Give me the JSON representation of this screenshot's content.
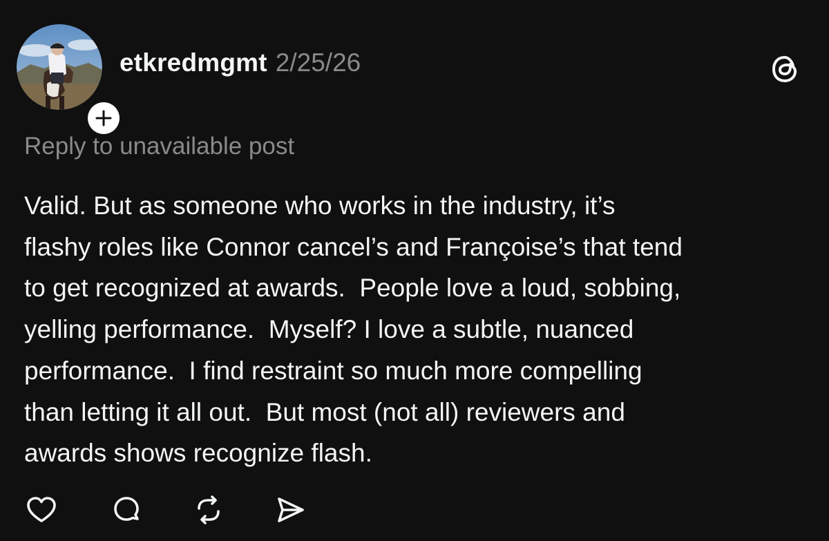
{
  "post": {
    "author": {
      "username": "etkredmgmt",
      "avatar_icon": "profile-photo-rider-on-horse",
      "follow_icon": "plus-icon"
    },
    "timestamp": "2/25/26",
    "app_icon": "threads-logo-icon",
    "reply_context": "Reply to unavailable post",
    "body_lines": [
      "Valid. But as someone who works in the industry, it’s",
      "flashy roles like Connor cancel’s and Françoise’s that tend",
      "to get recognized at awards.  People love a loud, sobbing,",
      "yelling performance.  Myself? I love a subtle, nuanced",
      "performance.  I find restraint so much more compelling",
      "than letting it all out.  But most (not all) reviewers and",
      "awards shows recognize flash."
    ],
    "actions": [
      {
        "name": "like",
        "icon": "heart-icon"
      },
      {
        "name": "reply",
        "icon": "comment-bubble-icon"
      },
      {
        "name": "repost",
        "icon": "repost-icon"
      },
      {
        "name": "share",
        "icon": "send-icon"
      }
    ]
  },
  "colors": {
    "background": "#101010",
    "primary_text": "#f3f5f7",
    "secondary_text": "#8a8a8a"
  }
}
